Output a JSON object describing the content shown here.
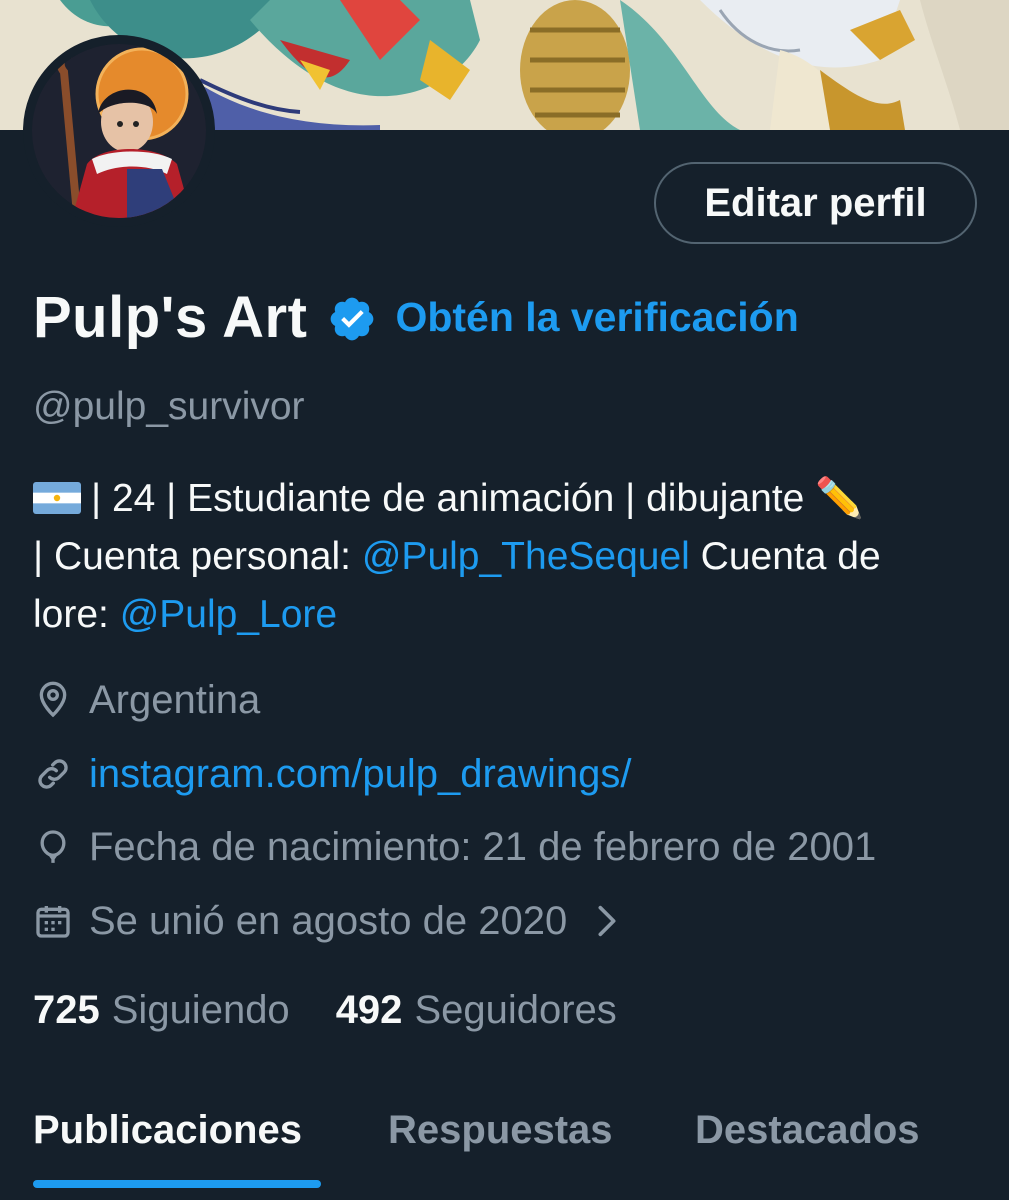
{
  "profile": {
    "edit_button": "Editar perfil",
    "display_name": "Pulp's Art",
    "verify_link": "Obtén la verificación",
    "handle": "@pulp_survivor",
    "bio": {
      "line1": "| 24 | Estudiante de animación | dibujante ✏️",
      "line2_prefix": "| Cuenta personal: ",
      "mention1": "@Pulp_TheSequel",
      "line2_suffix": " Cuenta de",
      "line3_prefix": "lore: ",
      "mention2": "@Pulp_Lore"
    },
    "location": "Argentina",
    "website": "instagram.com/pulp_drawings/",
    "birthday": "Fecha de nacimiento: 21 de febrero de 2001",
    "joined": "Se unió en agosto de 2020"
  },
  "stats": {
    "following_count": "725",
    "following_label": "Siguiendo",
    "followers_count": "492",
    "followers_label": "Seguidores"
  },
  "tabs": [
    {
      "label": "Publicaciones",
      "active": true
    },
    {
      "label": "Respuestas",
      "active": false
    },
    {
      "label": "Destacados",
      "active": false
    }
  ],
  "icons": {
    "verified": "verified-badge-icon",
    "location": "location-pin-icon",
    "website": "link-icon",
    "birthday": "balloon-icon",
    "joined": "calendar-icon",
    "more": "chevron-right-icon"
  },
  "colors": {
    "background": "#15202b",
    "accent": "#1d9bf0",
    "text_primary": "#f7f9f9",
    "text_secondary": "#8b98a5"
  }
}
